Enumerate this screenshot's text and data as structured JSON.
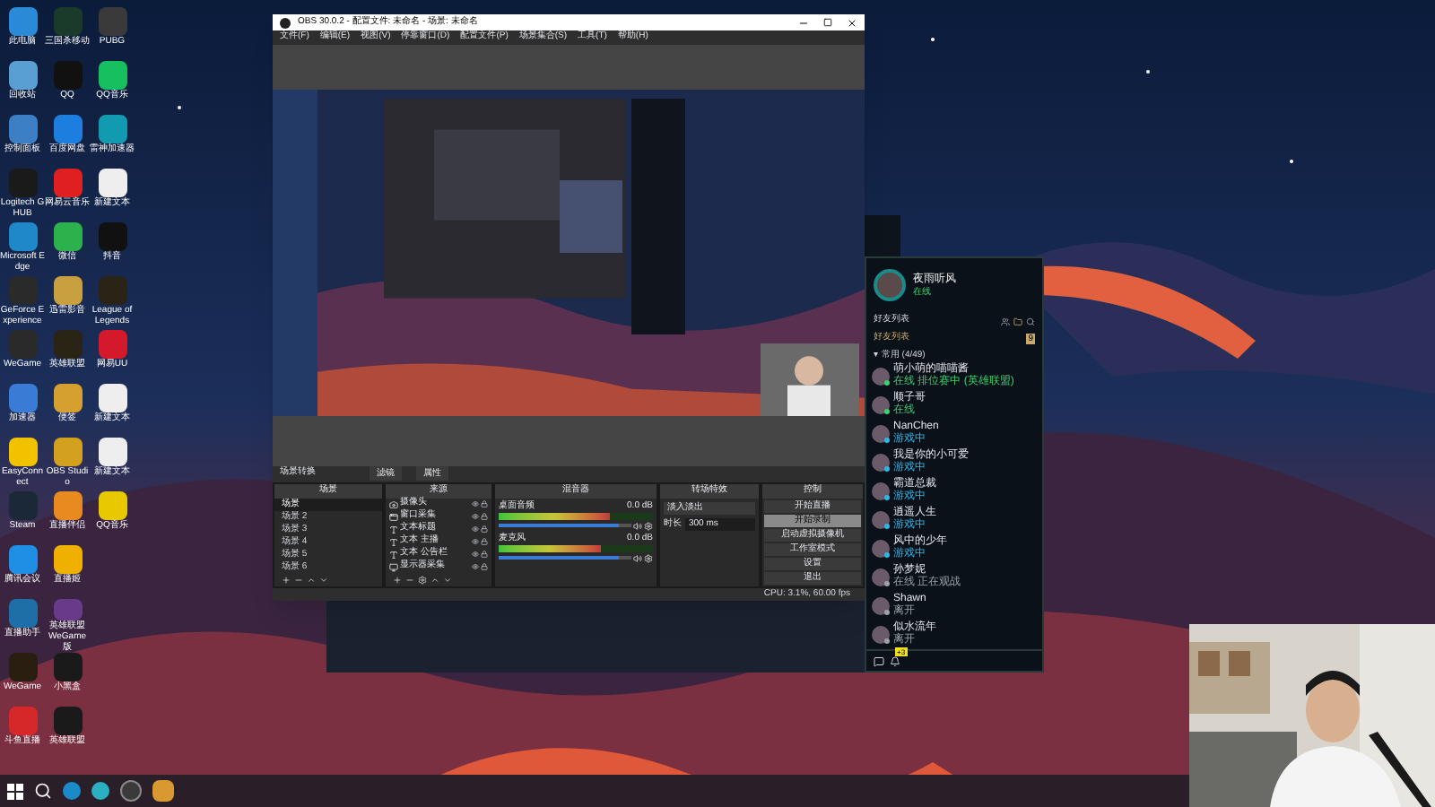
{
  "desktop_icons": [
    {
      "label": "此电脑",
      "color": "#2b8ad8"
    },
    {
      "label": "回收站",
      "color": "#5a9fd4"
    },
    {
      "label": "控制面板",
      "color": "#3d7fc4"
    },
    {
      "label": "Logitech G HUB",
      "color": "#1a1a1a"
    },
    {
      "label": "Microsoft Edge",
      "color": "#1e88c8"
    },
    {
      "label": "GeForce Experience",
      "color": "#2a2a2a"
    },
    {
      "label": "WeGame",
      "color": "#2a2a2a"
    },
    {
      "label": "加速器",
      "color": "#3a7bd5"
    },
    {
      "label": "EasyConnect",
      "color": "#f2c200"
    },
    {
      "label": "Steam",
      "color": "#1b2838"
    },
    {
      "label": "腾讯会议",
      "color": "#1f8fe6"
    },
    {
      "label": "直播助手",
      "color": "#1e6fa8"
    },
    {
      "label": "WeGame",
      "color": "#2a1e10"
    },
    {
      "label": "斗鱼直播",
      "color": "#d62828"
    },
    {
      "label": "三国杀移动",
      "color": "#1a3a2a"
    },
    {
      "label": "QQ",
      "color": "#111111"
    },
    {
      "label": "百度网盘",
      "color": "#1c7fe0"
    },
    {
      "label": "网易云音乐",
      "color": "#e02020"
    },
    {
      "label": "微信",
      "color": "#2bb24c"
    },
    {
      "label": "迅雷影音",
      "color": "#c8a040"
    },
    {
      "label": "英雄联盟",
      "color": "#2a2416"
    },
    {
      "label": "便签",
      "color": "#d6a030"
    },
    {
      "label": "OBS Studio",
      "color": "#d4a020"
    },
    {
      "label": "直播伴侣",
      "color": "#e88a20"
    },
    {
      "label": "直播姬",
      "color": "#f0b000"
    },
    {
      "label": "英雄联盟 WeGame版",
      "color": "#6a3a8a"
    },
    {
      "label": "小黑盒",
      "color": "#1a1a1a"
    },
    {
      "label": "英雄联盟",
      "color": "#1a1a1a"
    },
    {
      "label": "PUBG",
      "color": "#3a3a3a"
    },
    {
      "label": "QQ音乐",
      "color": "#16c060"
    },
    {
      "label": "雷神加速器",
      "color": "#129ab0"
    },
    {
      "label": "新建文本",
      "color": "#eeeeee"
    },
    {
      "label": "抖音",
      "color": "#111111"
    },
    {
      "label": "League of Legends",
      "color": "#2a2416"
    },
    {
      "label": "网易UU",
      "color": "#d41a2a"
    },
    {
      "label": "新建文本",
      "color": "#eeeeee"
    },
    {
      "label": "新建文本",
      "color": "#eeeeee"
    },
    {
      "label": "QQ音乐",
      "color": "#e8c800"
    }
  ],
  "obs": {
    "title": "OBS 30.0.2 - 配置文件: 未命名 - 场景: 未命名",
    "menu": [
      "文件(F)",
      "编辑(E)",
      "视图(V)",
      "停靠窗口(D)",
      "配置文件(P)",
      "场景集合(S)",
      "工具(T)",
      "帮助(H)"
    ],
    "dock_title": "场景转换",
    "dock_buttons": [
      "滤镜",
      "属性"
    ],
    "headers": [
      "场景",
      "来源",
      "混音器",
      "转场特效",
      "控制"
    ],
    "scenes": [
      {
        "label": "场景",
        "selected": true
      },
      {
        "label": "场景 2",
        "selected": false
      },
      {
        "label": "场景 3",
        "selected": false
      },
      {
        "label": "场景 4",
        "selected": false
      },
      {
        "label": "场景 5",
        "selected": false
      },
      {
        "label": "场景 6",
        "selected": false
      }
    ],
    "sources": [
      {
        "label": "摄像头",
        "kind": "camera"
      },
      {
        "label": "窗口采集",
        "kind": "window"
      },
      {
        "label": "文本标题",
        "kind": "text"
      },
      {
        "label": "文本 主播",
        "kind": "text"
      },
      {
        "label": "文本 公告栏",
        "kind": "text"
      },
      {
        "label": "显示器采集",
        "kind": "display"
      }
    ],
    "mixer": [
      {
        "name": "桌面音频",
        "reading": "0.0 dB",
        "level": 0.72,
        "volume": {
          "level": 0.9
        }
      },
      {
        "name": "麦克风",
        "reading": "0.0 dB",
        "level": 0.66,
        "volume": {
          "level": 0.9
        }
      }
    ],
    "transition": {
      "value": "淡入淡出",
      "duration_label": "时长",
      "duration": "300 ms"
    },
    "controls": [
      {
        "label": "开始直播",
        "selected": false
      },
      {
        "label": "开始录制",
        "selected": true
      },
      {
        "label": "启动虚拟摄像机",
        "selected": false
      },
      {
        "label": "工作室模式",
        "selected": false
      },
      {
        "label": "设置",
        "selected": false
      },
      {
        "label": "退出",
        "selected": false
      }
    ],
    "status": "CPU: 3.1%, 60.00 fps"
  },
  "chat": {
    "username": "夜雨听风",
    "status": "在线",
    "toolbar_label": "好友列表",
    "section": "好友列表",
    "group": "▾ 常用 (4/49)",
    "badge": "9",
    "friends": [
      {
        "name": "萌小萌的喵喵酱",
        "status": "在线 排位赛中 (英雄联盟)",
        "color": "#3bd16f"
      },
      {
        "name": "顺子哥",
        "status": "在线",
        "color": "#3bd16f"
      },
      {
        "name": "NanChen",
        "status": "游戏中",
        "color": "#2fb6e8"
      },
      {
        "name": "我是你的小可爱",
        "status": "游戏中",
        "color": "#2fb6e8"
      },
      {
        "name": "霸道总裁",
        "status": "游戏中",
        "color": "#2fb6e8"
      },
      {
        "name": "逍遥人生",
        "status": "游戏中",
        "color": "#2fb6e8"
      },
      {
        "name": "风中的少年",
        "status": "游戏中",
        "color": "#2fb6e8"
      },
      {
        "name": "孙梦妮",
        "status": "在线 正在观战",
        "color": "#9aa3a8"
      },
      {
        "name": "Shawn",
        "status": "离开",
        "color": "#9aa3a8"
      },
      {
        "name": "似水流年",
        "status": "离开",
        "color": "#9aa3a8"
      }
    ],
    "footer_badge": "+3"
  }
}
